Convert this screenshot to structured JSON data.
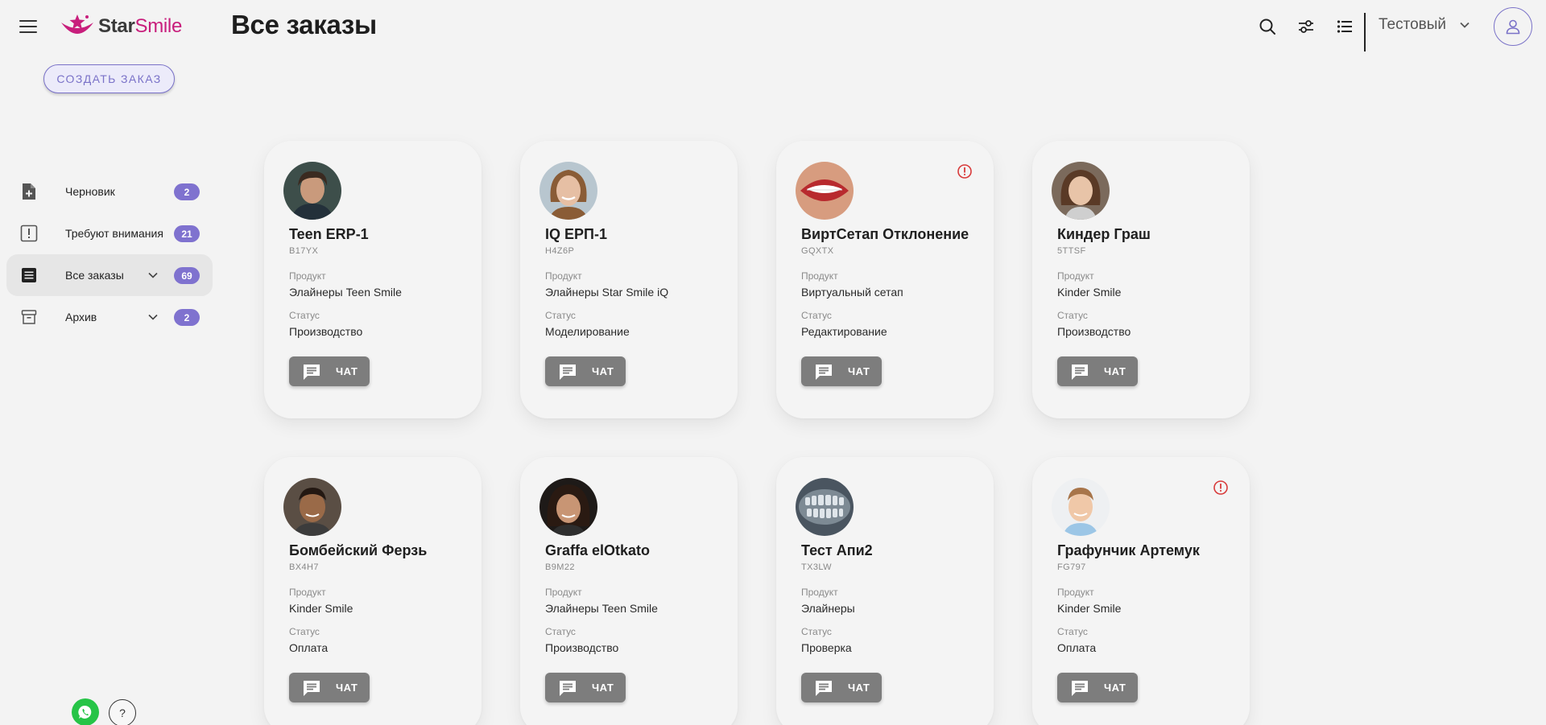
{
  "header": {
    "brand_star": "Star",
    "brand_smile": "Smile",
    "title": "Все заказы",
    "user_name": "Тестовый",
    "icons": [
      "menu-icon",
      "search-icon",
      "filter-icon",
      "list-view-icon",
      "chevron-down-icon",
      "user-icon"
    ]
  },
  "create_button": "СОЗДАТЬ ЗАКАЗ",
  "sidebar": {
    "items": [
      {
        "label": "Черновик",
        "count": "2",
        "icon": "draft-add-icon"
      },
      {
        "label": "Требуют внимания",
        "count": "21",
        "icon": "attention-icon"
      },
      {
        "label": "Все заказы",
        "count": "69",
        "icon": "all-orders-icon",
        "active": true
      },
      {
        "label": "Архив",
        "count": "2",
        "icon": "archive-icon"
      }
    ]
  },
  "help_label": "?",
  "card_labels": {
    "product": "Продукт",
    "status": "Статус",
    "chat": "ЧАТ"
  },
  "orders": [
    {
      "name": "Teen ERP-1",
      "code": "B17YX",
      "product": "Элайнеры Teen Smile",
      "status": "Производство",
      "warning": false
    },
    {
      "name": "IQ ЕРП-1",
      "code": "H4Z6P",
      "product": "Элайнеры Star Smile iQ",
      "status": "Моделирование",
      "warning": false
    },
    {
      "name": "ВиртСетап Отклонение",
      "code": "GQXTX",
      "product": "Виртуальный сетап",
      "status": "Редактирование",
      "warning": true
    },
    {
      "name": "Киндер Граш",
      "code": "5TTSF",
      "product": "Kinder Smile",
      "status": "Производство",
      "warning": false
    },
    {
      "name": "Бомбейский Ферзь",
      "code": "BX4H7",
      "product": "Kinder Smile",
      "status": "Оплата",
      "warning": false
    },
    {
      "name": "Graffa elOtkato",
      "code": "B9M22",
      "product": "Элайнеры Teen Smile",
      "status": "Производство",
      "warning": false
    },
    {
      "name": "Тест Апи2",
      "code": "TX3LW",
      "product": "Элайнеры",
      "status": "Проверка",
      "warning": false
    },
    {
      "name": "Графунчик Артемук",
      "code": "FG797",
      "product": "Kinder Smile",
      "status": "Оплата",
      "warning": true
    }
  ],
  "colors": {
    "accent": "#7f72cf",
    "brand": "#c81e7c",
    "warning": "#d83a3a",
    "chat_button": "#7d7d7d"
  }
}
